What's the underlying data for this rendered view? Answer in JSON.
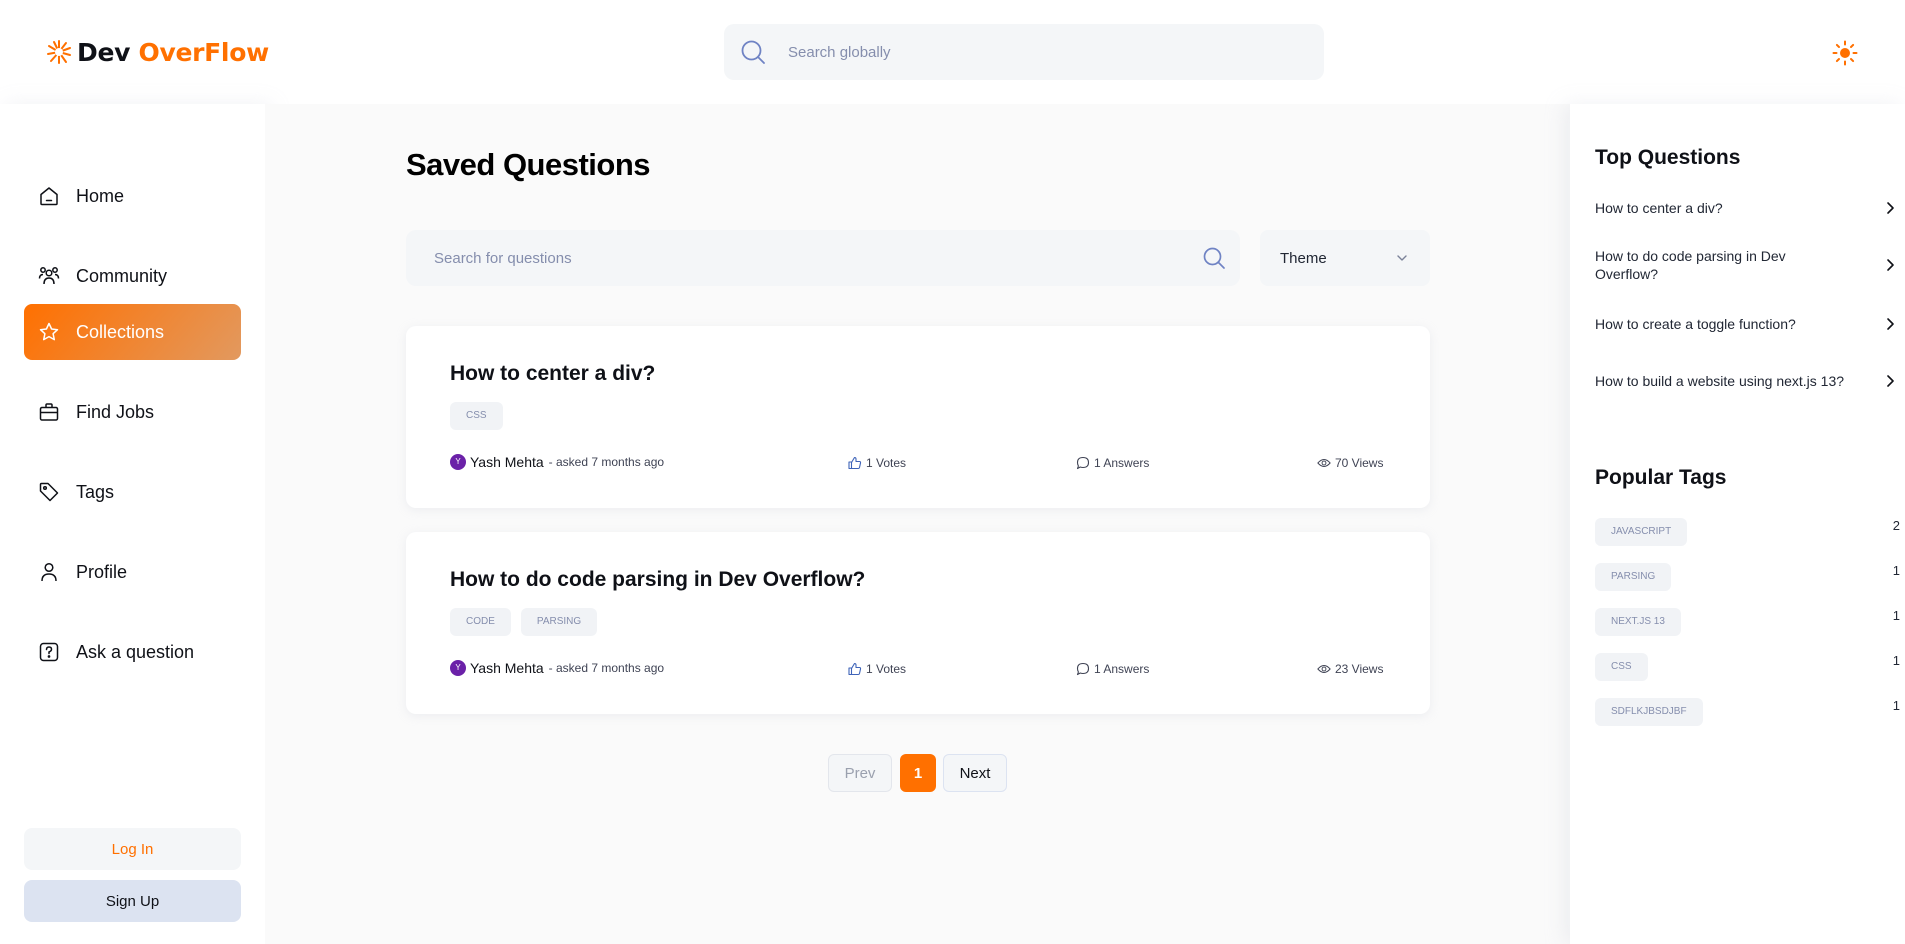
{
  "header": {
    "logo_dev": "Dev",
    "logo_overflow": "OverFlow",
    "search_placeholder": "Search globally"
  },
  "sidebar": {
    "items": [
      {
        "label": "Home",
        "icon": "home-icon"
      },
      {
        "label": "Community",
        "icon": "users-icon"
      },
      {
        "label": "Collections",
        "icon": "star-icon",
        "active": true
      },
      {
        "label": "Find Jobs",
        "icon": "briefcase-icon"
      },
      {
        "label": "Tags",
        "icon": "tag-icon"
      },
      {
        "label": "Profile",
        "icon": "user-icon"
      },
      {
        "label": "Ask a question",
        "icon": "question-icon"
      }
    ],
    "login_label": "Log In",
    "signup_label": "Sign Up"
  },
  "main": {
    "title": "Saved Questions",
    "search_placeholder": "Search for questions",
    "filter_label": "Theme",
    "questions": [
      {
        "title": "How to center a div?",
        "tags": [
          "CSS"
        ],
        "author": "Yash Mehta",
        "avatar_initial": "Y",
        "asked": "- asked 7 months ago",
        "votes": "1 Votes",
        "answers": "1 Answers",
        "views": "70 Views"
      },
      {
        "title": "How to do code parsing in Dev Overflow?",
        "tags": [
          "CODE",
          "PARSING"
        ],
        "author": "Yash Mehta",
        "avatar_initial": "Y",
        "asked": "- asked 7 months ago",
        "votes": "1 Votes",
        "answers": "1 Answers",
        "views": "23 Views"
      }
    ],
    "pagination": {
      "prev": "Prev",
      "page": "1",
      "next": "Next"
    }
  },
  "right_sidebar": {
    "top_questions_title": "Top Questions",
    "top_questions": [
      "How to center a div?",
      "How to do code parsing in Dev Overflow?",
      "How to create a toggle function?",
      "How to build a website using next.js 13?"
    ],
    "popular_tags_title": "Popular Tags",
    "popular_tags": [
      {
        "name": "JAVASCRIPT",
        "count": "2"
      },
      {
        "name": "PARSING",
        "count": "1"
      },
      {
        "name": "NEXT.JS 13",
        "count": "1"
      },
      {
        "name": "CSS",
        "count": "1"
      },
      {
        "name": "SDFLKJBSDJBF",
        "count": "1"
      }
    ]
  },
  "colors": {
    "accent": "#ff7000",
    "accent_gradient_end": "#e2995f",
    "avatar": "#6b21a8"
  }
}
